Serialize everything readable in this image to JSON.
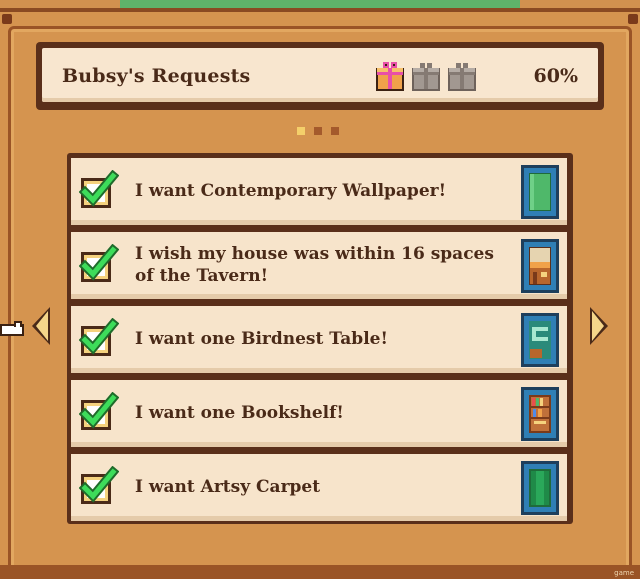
{
  "header": {
    "title": "Bubsy's Requests",
    "progress_text": "60%",
    "progress_value": 0.6,
    "gifts": [
      {
        "icon": "gift-icon",
        "state": "earned"
      },
      {
        "icon": "gift-icon",
        "state": "locked"
      },
      {
        "icon": "gift-icon",
        "state": "locked"
      }
    ]
  },
  "pagination": {
    "pages": 3,
    "current": 1
  },
  "requests": [
    {
      "text": "I want Contemporary Wallpaper!",
      "completed": true,
      "icon": "wallpaper-book-icon"
    },
    {
      "text_line1": "I wish my house was within 16 spaces",
      "text_line2": "of the Tavern!",
      "completed": true,
      "icon": "tavern-book-icon"
    },
    {
      "text": "I want one Birdnest Table!",
      "completed": true,
      "icon": "table-book-icon"
    },
    {
      "text": "I want one Bookshelf!",
      "completed": true,
      "icon": "bookshelf-book-icon"
    },
    {
      "text": "I want Artsy Carpet",
      "completed": true,
      "icon": "carpet-book-icon"
    }
  ],
  "colors": {
    "panel": "#d5944f",
    "card": "#f7e4cb",
    "text": "#4a2a18",
    "check": "#3ddc5a",
    "book": "#2f7fb5"
  },
  "watermark": "game"
}
